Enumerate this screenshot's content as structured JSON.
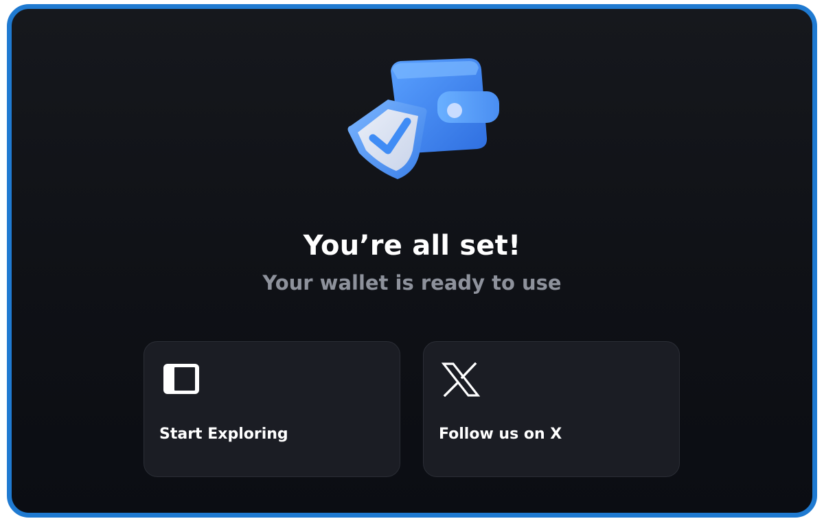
{
  "colors": {
    "frame_border": "#1f7ad1",
    "background": "#0f1116",
    "card_background": "#1b1d24",
    "title_text": "#ffffff",
    "subtitle_text": "#8e929c",
    "accent": "#3f8cf5"
  },
  "hero": {
    "icon": "wallet-shield-icon"
  },
  "header": {
    "title": "You’re all set!",
    "subtitle": "Your wallet is ready to use"
  },
  "cards": [
    {
      "label": "Start Exploring",
      "icon": "sidebar-panel-icon"
    },
    {
      "label": "Follow us on X",
      "icon": "x-logo-icon"
    }
  ]
}
